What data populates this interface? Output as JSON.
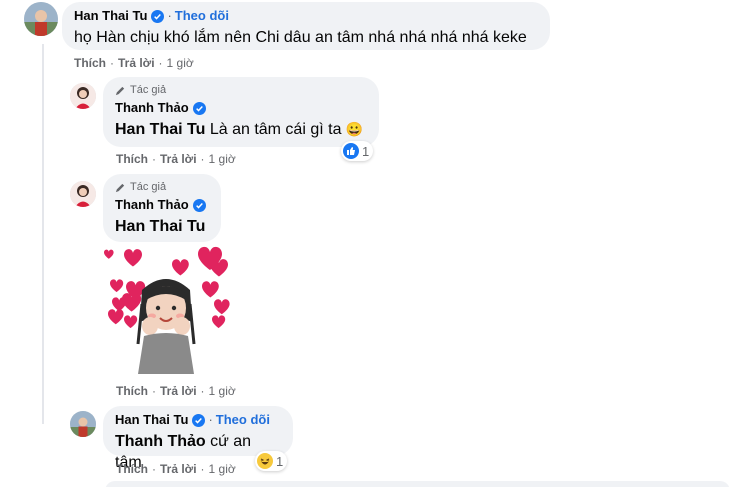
{
  "comments": [
    {
      "author": "Han Thai Tu",
      "verified": true,
      "follow_label": "Theo dõi",
      "text": "họ Hàn chịu khó lắm nên Chi dâu an tâm nhá nhá nhá nhá keke",
      "actions": {
        "like": "Thích",
        "reply": "Trả lời",
        "time": "1 giờ"
      }
    },
    {
      "author_tag": "Tác giả",
      "author": "Thanh Thảo",
      "verified": true,
      "mention": "Han Thai Tu",
      "text": "Là an tâm cái gì ta",
      "emoji": "😀",
      "reaction_count": "1",
      "actions": {
        "like": "Thích",
        "reply": "Trả lời",
        "time": "1 giờ"
      }
    },
    {
      "author_tag": "Tác giả",
      "author": "Thanh Thảo",
      "verified": true,
      "mention": "Han Thai Tu",
      "actions": {
        "like": "Thích",
        "reply": "Trả lời",
        "time": "1 giờ"
      }
    },
    {
      "author": "Han Thai Tu",
      "verified": true,
      "follow_label": "Theo dõi",
      "mention": "Thanh Thảo",
      "text": "cứ an tâm",
      "reaction_count": "1",
      "actions": {
        "like": "Thích",
        "reply": "Trả lời",
        "time": "1 giờ"
      }
    }
  ],
  "colors": {
    "bubble": "#f0f2f5",
    "link": "#216fdb",
    "muted": "#65676b",
    "verified": "#1877f2",
    "heart": "#e0245e"
  },
  "icons": {
    "verified": "verified-badge-icon",
    "author": "pencil-icon",
    "like_reaction": "like-reaction-icon",
    "haha_reaction": "haha-reaction-icon",
    "sticker": "hearts-sticker"
  }
}
